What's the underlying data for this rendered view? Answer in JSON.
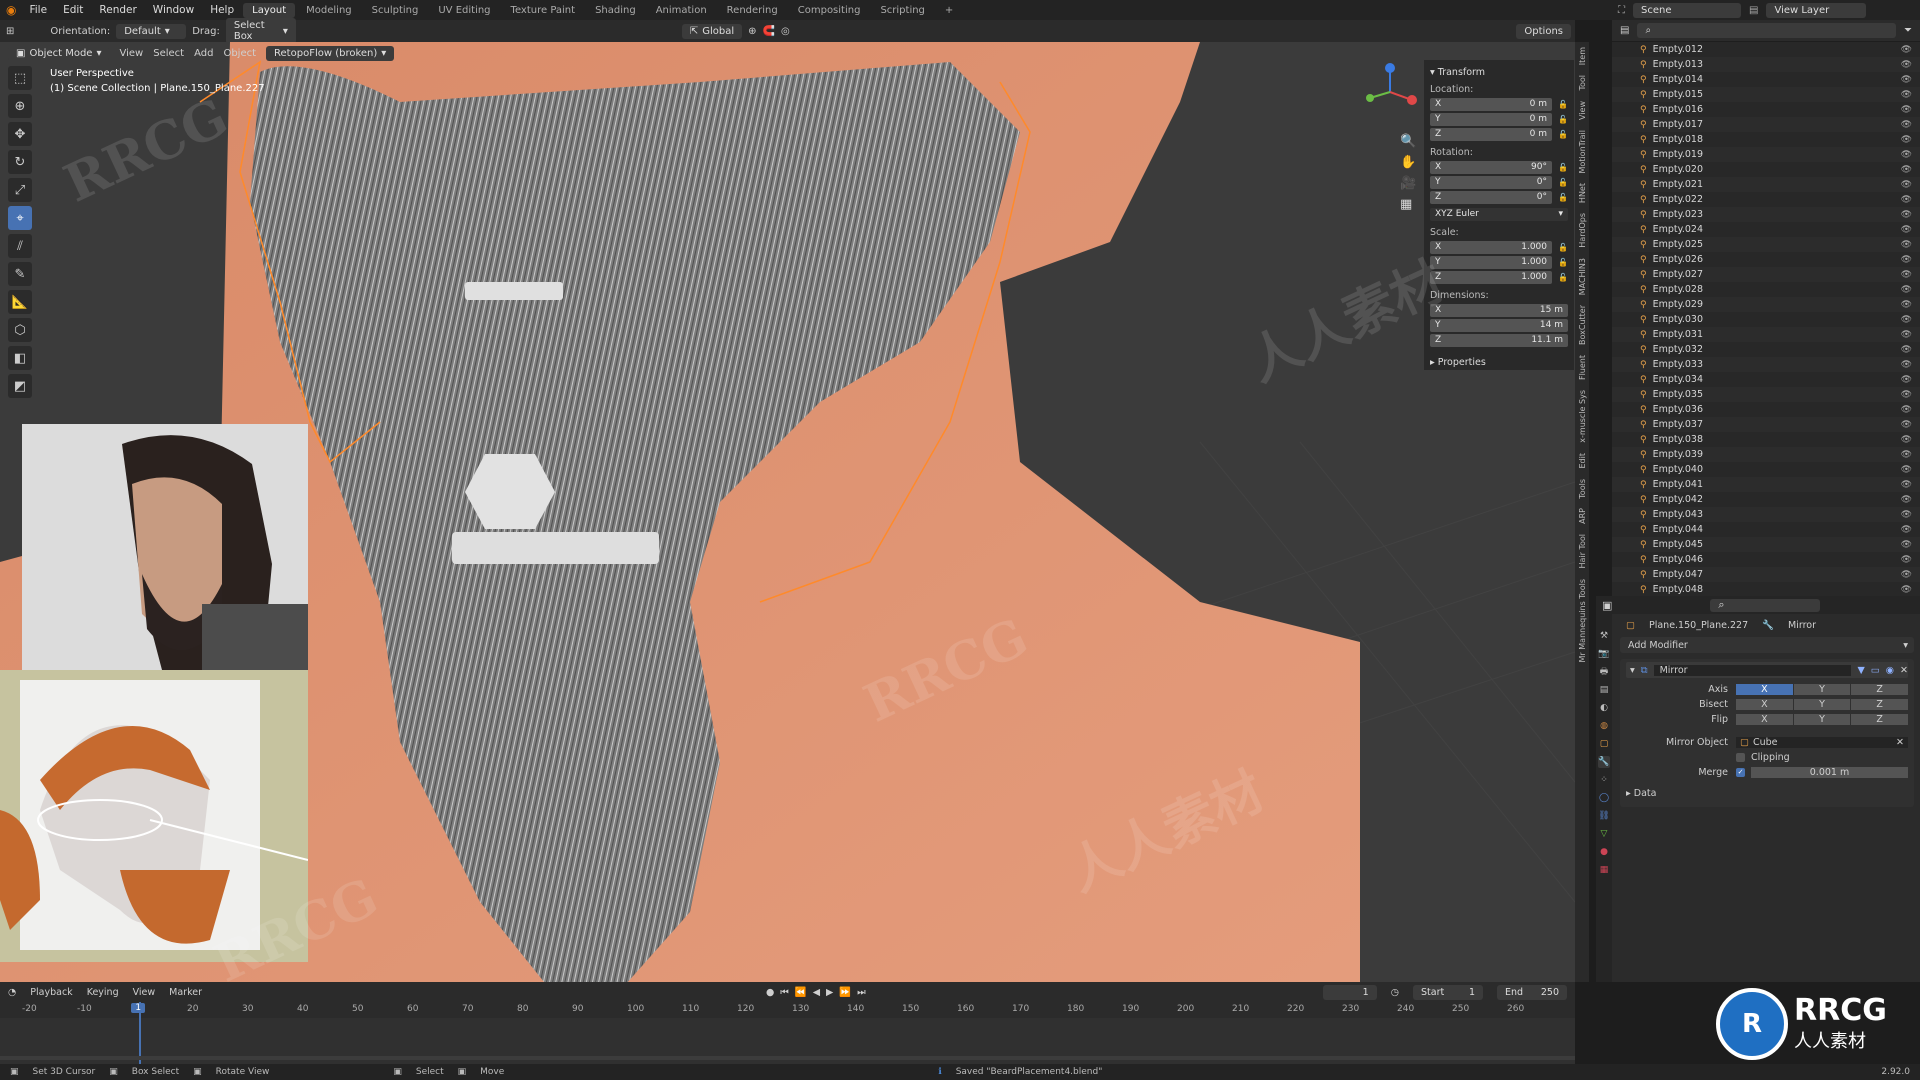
{
  "menu": [
    "File",
    "Edit",
    "Render",
    "Window",
    "Help"
  ],
  "workspaces": [
    "Layout",
    "Modeling",
    "Sculpting",
    "UV Editing",
    "Texture Paint",
    "Shading",
    "Animation",
    "Rendering",
    "Compositing",
    "Scripting",
    "+"
  ],
  "scene": {
    "label": "Scene",
    "view_layer": "View Layer"
  },
  "header": {
    "orientation_label": "Orientation:",
    "orientation_value": "Default",
    "drag_label": "Drag:",
    "drag_value": "Select Box",
    "transform_space": "Global",
    "options": "Options"
  },
  "viewport_header": {
    "mode": "Object Mode",
    "menus": [
      "View",
      "Select",
      "Add",
      "Object"
    ],
    "addon_label": "RetopoFlow (broken)"
  },
  "viewport_info": {
    "line1": "User Perspective",
    "line2": "(1) Scene Collection | Plane.150_Plane.227"
  },
  "npanel": {
    "transform_label": "Transform",
    "location_label": "Location:",
    "location": {
      "x": "0 m",
      "y": "0 m",
      "z": "0 m"
    },
    "rotation_label": "Rotation:",
    "rotation": {
      "x": "90°",
      "y": "0°",
      "z": "0°"
    },
    "rotation_mode": "XYZ Euler",
    "scale_label": "Scale:",
    "scale": {
      "x": "1.000",
      "y": "1.000",
      "z": "1.000"
    },
    "dimensions_label": "Dimensions:",
    "dimensions": {
      "x": "15 m",
      "y": "14 m",
      "z": "11.1 m"
    },
    "properties_label": "Properties",
    "axis_x": "X",
    "axis_y": "Y",
    "axis_z": "Z"
  },
  "side_tabs": [
    "Item",
    "Tool",
    "View",
    "MotionTrail",
    "HNet",
    "HardOps",
    "MACHIN3",
    "BoxCutter",
    "Fluent",
    "x-muscle Sys",
    "Edit",
    "Tools",
    "ARP",
    "Hair Tool",
    "Mr Mannequins Tools"
  ],
  "outliner_items": [
    "Empty.012",
    "Empty.013",
    "Empty.014",
    "Empty.015",
    "Empty.016",
    "Empty.017",
    "Empty.018",
    "Empty.019",
    "Empty.020",
    "Empty.021",
    "Empty.022",
    "Empty.023",
    "Empty.024",
    "Empty.025",
    "Empty.026",
    "Empty.027",
    "Empty.028",
    "Empty.029",
    "Empty.030",
    "Empty.031",
    "Empty.032",
    "Empty.033",
    "Empty.034",
    "Empty.035",
    "Empty.036",
    "Empty.037",
    "Empty.038",
    "Empty.039",
    "Empty.040",
    "Empty.041",
    "Empty.042",
    "Empty.043",
    "Empty.044",
    "Empty.045",
    "Empty.046",
    "Empty.047",
    "Empty.048"
  ],
  "properties": {
    "object_name": "Plane.150_Plane.227",
    "modifier_name": "Mirror",
    "add_modifier": "Add Modifier",
    "axis_label": "Axis",
    "bisect_label": "Bisect",
    "flip_label": "Flip",
    "x": "X",
    "y": "Y",
    "z": "Z",
    "mirror_object_label": "Mirror Object",
    "mirror_object": "Cube",
    "clipping_label": "Clipping",
    "merge_label": "Merge",
    "merge_value": "0.001 m",
    "data_label": "Data"
  },
  "timeline": {
    "menus": [
      "Playback",
      "Keying",
      "View",
      "Marker"
    ],
    "current_frame": "1",
    "start_label": "Start",
    "start": "1",
    "end_label": "End",
    "end": "250",
    "ticks": [
      "-20",
      "-10",
      "10",
      "20",
      "30",
      "40",
      "50",
      "60",
      "70",
      "80",
      "90",
      "100",
      "110",
      "120",
      "130",
      "140",
      "150",
      "160",
      "170",
      "180",
      "190",
      "200",
      "210",
      "220",
      "230",
      "240",
      "250",
      "260"
    ],
    "playhead": "1"
  },
  "status": {
    "set_cursor": "Set 3D Cursor",
    "box_select": "Box Select",
    "rotate_view": "Rotate View",
    "select": "Select",
    "move": "Move",
    "message": "Saved \"BeardPlacement4.blend\"",
    "version": "2.92.0"
  },
  "watermarks": [
    "RRCG",
    "人人素材"
  ],
  "logo": {
    "brand": "RRCG",
    "sub": "人人素材"
  },
  "colors": {
    "accent": "#4772b3",
    "skin": "#d98d6d",
    "outline": "#ff8a2a",
    "hair": "#9a9a9a"
  }
}
